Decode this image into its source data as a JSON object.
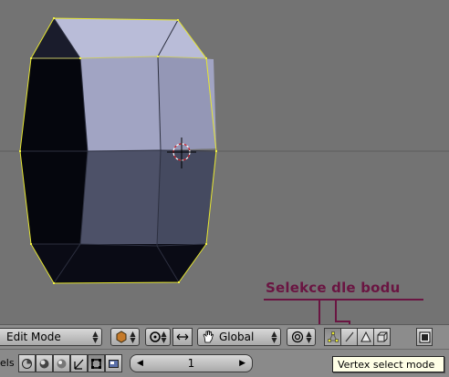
{
  "annotation": {
    "label": "Selekce dle bodu",
    "color": "#6a1542"
  },
  "header": {
    "mode_select": {
      "value": "Edit Mode"
    },
    "orientation_select": {
      "value": "Global"
    },
    "select_modes": [
      {
        "name": "vertex",
        "icon": "vertex-select-icon",
        "active": true
      },
      {
        "name": "edge",
        "icon": "edge-select-icon",
        "active": false
      },
      {
        "name": "face",
        "icon": "face-select-icon",
        "active": false
      },
      {
        "name": "occlude",
        "icon": "occlude-geometry-icon",
        "active": false
      }
    ]
  },
  "bottom_bar": {
    "panel_label": "els",
    "frame_number": "1"
  },
  "tooltip": {
    "text": "Vertex select mode"
  },
  "viewport": {
    "background": "#737373",
    "mesh_light_face": "#9fa2c1",
    "mesh_mid_face": "#4c5066",
    "mesh_dark_face": "#06070f",
    "edge_color": "#e8e830"
  }
}
